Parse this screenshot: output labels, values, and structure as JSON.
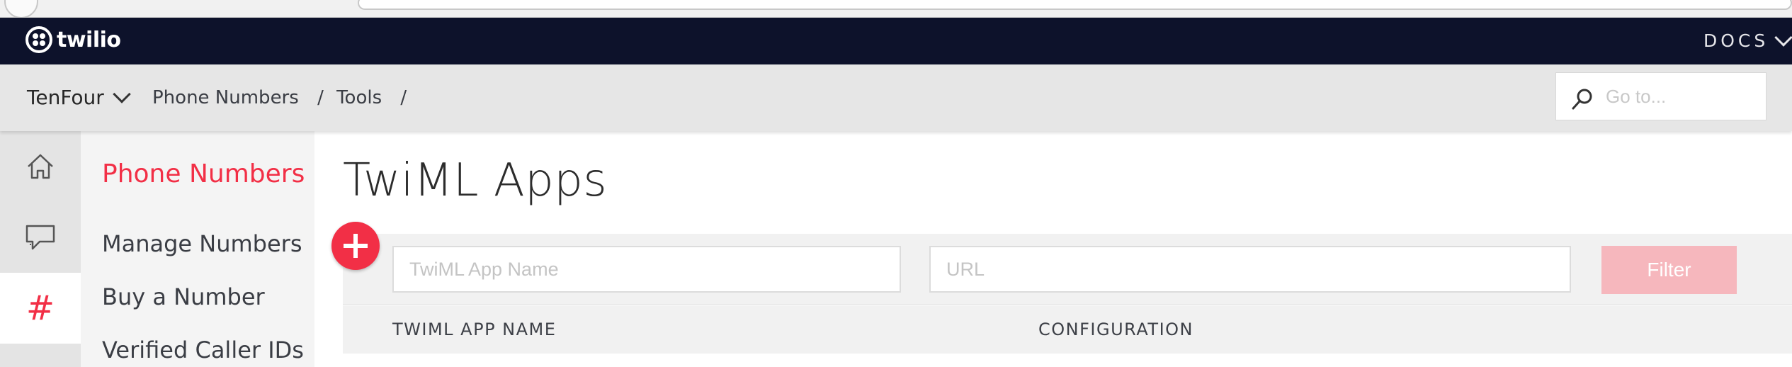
{
  "brand": {
    "name": "twilio"
  },
  "topbar": {
    "docs_label": "DOCS"
  },
  "subbar": {
    "account": "TenFour",
    "breadcrumbs": [
      "Phone Numbers",
      "Tools"
    ],
    "separator": "/",
    "goto_placeholder": "Go to..."
  },
  "rail": {
    "items": [
      {
        "icon": "home-icon"
      },
      {
        "icon": "chat-icon"
      },
      {
        "icon": "hash-icon",
        "glyph": "#",
        "active": true
      }
    ]
  },
  "subnav": {
    "title": "Phone Numbers",
    "items": [
      "Manage Numbers",
      "Buy a Number",
      "Verified Caller IDs"
    ]
  },
  "main": {
    "title": "TwiML Apps",
    "filters": {
      "name_placeholder": "TwiML App Name",
      "url_placeholder": "URL",
      "button_label": "Filter"
    },
    "table": {
      "columns": [
        "TWIML APP NAME",
        "CONFIGURATION"
      ]
    }
  },
  "colors": {
    "brand_red": "#f22f46",
    "topbar_navy": "#0d122b",
    "filter_disabled": "#f6b7bd"
  }
}
